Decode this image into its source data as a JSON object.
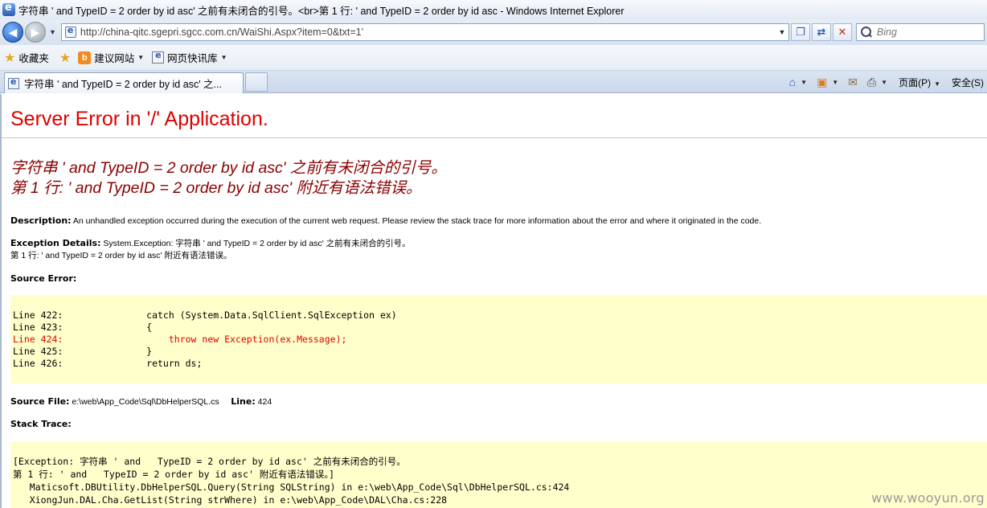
{
  "window": {
    "title": "字符串 ' and   TypeID = 2 order by id asc' 之前有未闭合的引号。<br>第 1 行: ' and   TypeID = 2 order by id asc - Windows Internet Explorer"
  },
  "address": {
    "url": "http://china-qitc.sgepri.sgcc.com.cn/WaiShi.Aspx?item=0&txt=1'",
    "search_placeholder": "Bing"
  },
  "favorites": {
    "label": "收藏夹",
    "items": [
      "建议网站",
      "网页快讯库"
    ]
  },
  "tab": {
    "label": "字符串 ' and   TypeID = 2 order by id asc' 之..."
  },
  "command_bar": {
    "page": "页面(P)",
    "safety": "安全(S)"
  },
  "error_page": {
    "title": "Server Error in '/' Application.",
    "message_line1": "字符串 ' and   TypeID = 2 order by id asc' 之前有未闭合的引号。",
    "message_line2": "第 1 行: ' and   TypeID = 2 order by id asc' 附近有语法错误。",
    "description_label": "Description:",
    "description_text": "An unhandled exception occurred during the execution of the current web request. Please review the stack trace for more information about the error and where it originated in the code.",
    "exception_label": "Exception Details:",
    "exception_text_line1": "System.Exception: 字符串 ' and   TypeID = 2 order by id asc' 之前有未闭合的引号。",
    "exception_text_line2": "第 1 行: ' and   TypeID = 2 order by id asc' 附近有语法错误。",
    "source_error_label": "Source Error:",
    "code_lines": [
      "Line 422:               catch (System.Data.SqlClient.SqlException ex)",
      "Line 423:               {",
      "Line 424:                   throw new Exception(ex.Message);",
      "Line 425:               }",
      "Line 426:               return ds;"
    ],
    "source_file_label": "Source File:",
    "source_file_value": "e:\\web\\App_Code\\Sql\\DbHelperSQL.cs",
    "line_label": "Line:",
    "line_value": "424",
    "stack_trace_label": "Stack Trace:",
    "stack_lines": [
      "[Exception: 字符串 ' and   TypeID = 2 order by id asc' 之前有未闭合的引号。",
      "第 1 行: ' and   TypeID = 2 order by id asc' 附近有语法错误。]",
      "   Maticsoft.DBUtility.DbHelperSQL.Query(String SQLString) in e:\\web\\App_Code\\Sql\\DbHelperSQL.cs:424",
      "   XiongJun.DAL.Cha.GetList(String strWhere) in e:\\web\\App_Code\\DAL\\Cha.cs:228"
    ]
  },
  "watermark": "www.wooyun.org"
}
